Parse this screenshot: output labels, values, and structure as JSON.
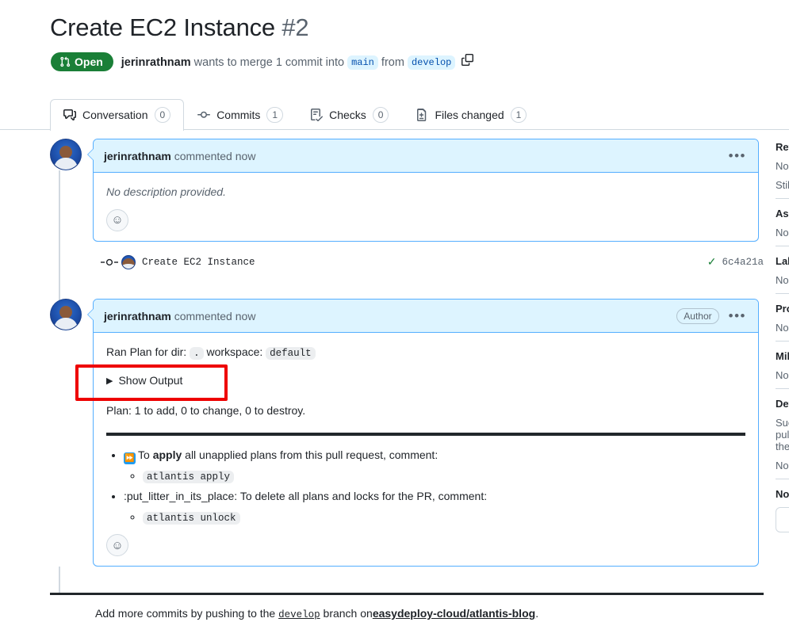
{
  "header": {
    "title": "Create EC2 Instance",
    "number": "#2",
    "state": "Open",
    "author": "jerinrathnam",
    "merge_text_1": "wants to merge 1 commit into",
    "base_branch": "main",
    "merge_text_2": "from",
    "head_branch": "develop",
    "copy_icon": "copy-icon"
  },
  "tabs": [
    {
      "label": "Conversation",
      "count": "0",
      "icon": "comment-discussion-icon",
      "active": true
    },
    {
      "label": "Commits",
      "count": "1",
      "icon": "git-commit-icon",
      "active": false
    },
    {
      "label": "Checks",
      "count": "0",
      "icon": "checklist-icon",
      "active": false
    },
    {
      "label": "Files changed",
      "count": "1",
      "icon": "file-diff-icon",
      "active": false
    }
  ],
  "comment1": {
    "author": "jerinrathnam",
    "action": "commented",
    "time": "now",
    "body": "No description provided.",
    "reaction_icon": "smiley-icon",
    "menu_icon": "kebab-menu-icon"
  },
  "commit": {
    "message": "Create EC2 Instance",
    "sha": "6c4a21a",
    "status_icon": "check-success-icon"
  },
  "comment2": {
    "author": "jerinrathnam",
    "action": "commented",
    "time": "now",
    "badge": "Author",
    "menu_icon": "kebab-menu-icon",
    "ran_plan_prefix": "Ran Plan for dir:",
    "ran_plan_dir": ".",
    "ran_plan_mid": "workspace:",
    "ran_plan_workspace": "default",
    "show_output": "Show Output",
    "plan_summary": "Plan: 1 to add, 0 to change, 0 to destroy.",
    "bullets": [
      {
        "emoji": "fast-forward-emoji",
        "text_before_bold": "To ",
        "bold": "apply",
        "text_after_bold": " all unapplied plans from this pull request, comment:",
        "command": "atlantis apply"
      },
      {
        "emoji": "",
        "text_before_bold": ":put_litter_in_its_place: To delete all plans and locks for the PR, comment:",
        "bold": "",
        "text_after_bold": "",
        "command": "atlantis unlock"
      }
    ],
    "reaction_icon": "smiley-icon"
  },
  "footer": {
    "prefix": "Add more commits by pushing to the",
    "branch": "develop",
    "middle": "branch on",
    "repo": "easydeploy-cloud/atlantis-blog",
    "suffix": "."
  },
  "sidebar": {
    "sections": [
      {
        "title": "Reviewers",
        "text": "No reviews",
        "extra": "Still in progress?"
      },
      {
        "title": "Assignees",
        "text": "No one assigned"
      },
      {
        "title": "Labels",
        "text": "None yet"
      },
      {
        "title": "Projects",
        "text": "None yet"
      },
      {
        "title": "Milestone",
        "text": "No milestone"
      },
      {
        "title": "Development",
        "text": "Successfully merging this pull request may close these issues.",
        "extra2": "None yet"
      },
      {
        "title": "Notifications"
      }
    ]
  },
  "annotation": {
    "color": "#ee0000",
    "target": "show-output-toggle"
  }
}
